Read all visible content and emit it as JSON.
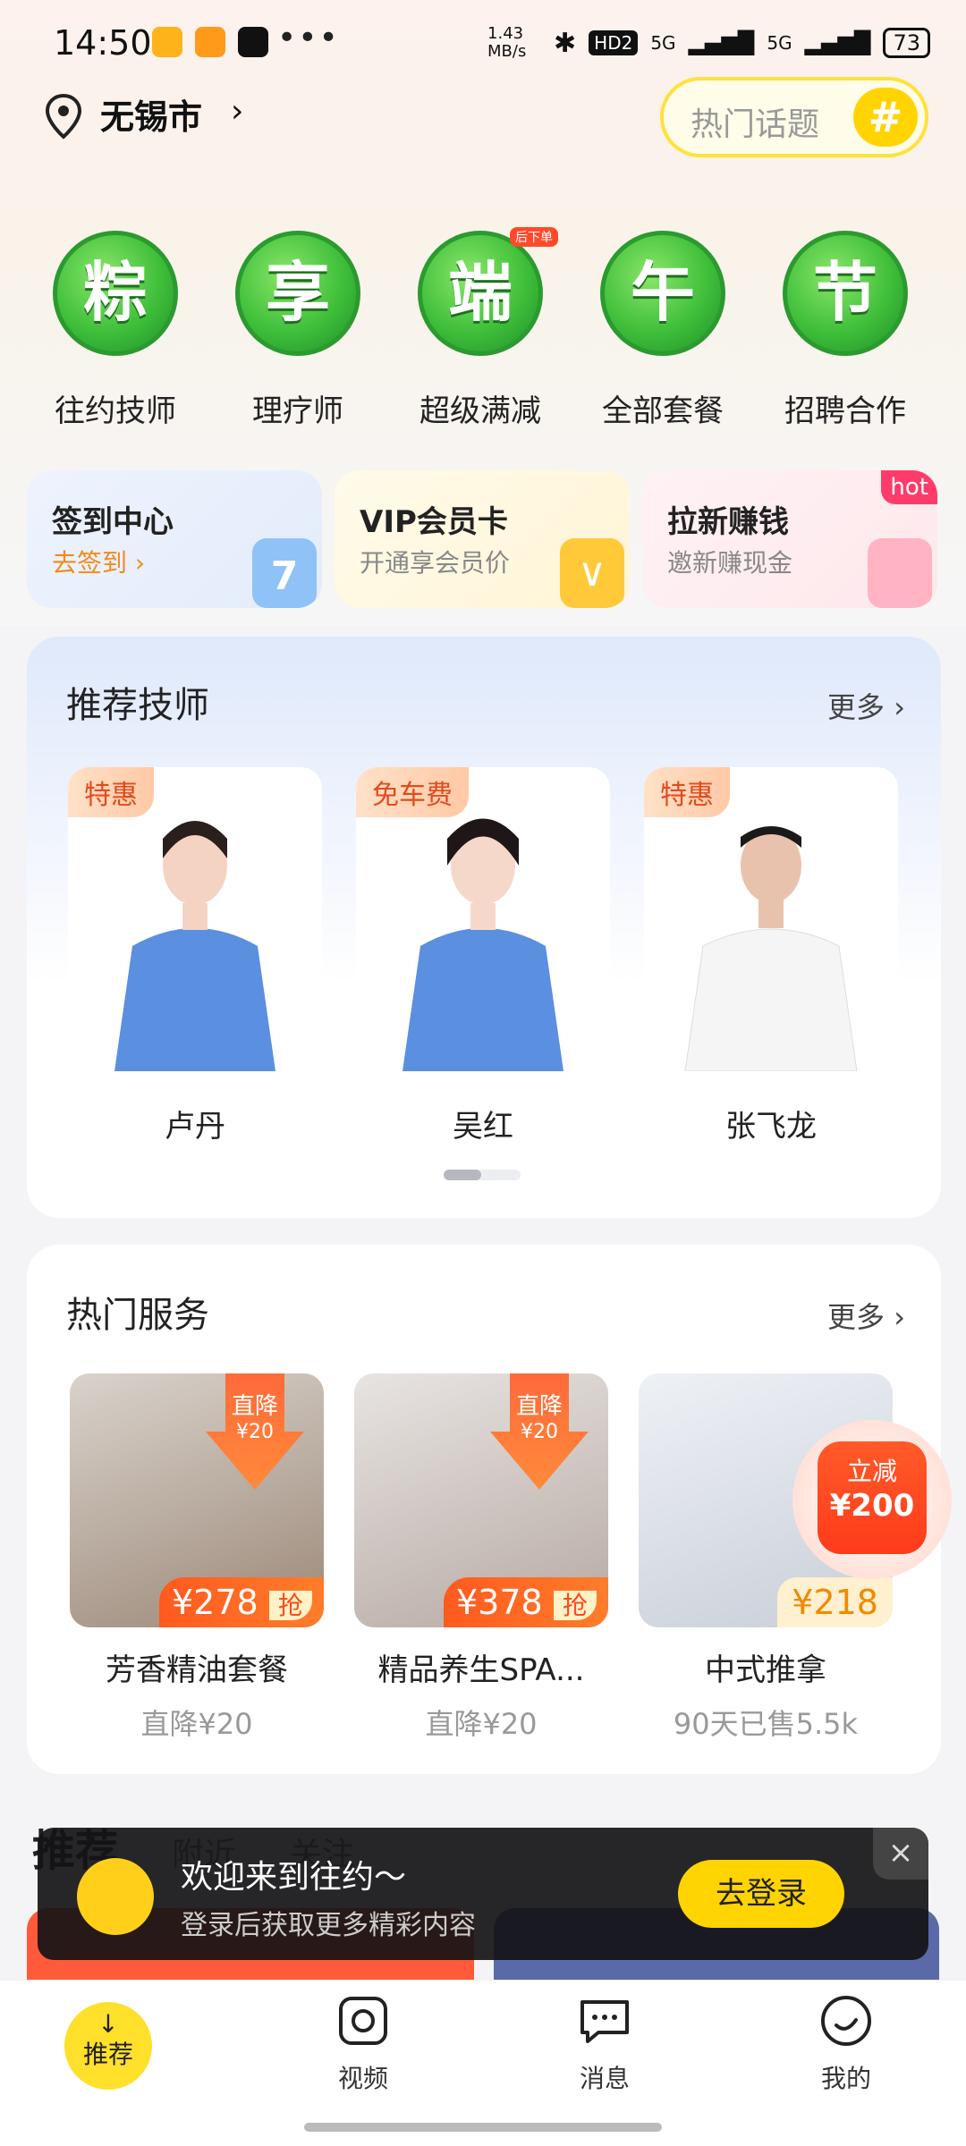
{
  "status": {
    "time": "14:50",
    "more": "•••",
    "net_speed": "1.43 MB/s",
    "hd": "HD2",
    "signal1": "5G",
    "signal2": "5G",
    "battery": "73"
  },
  "header": {
    "city": "无锡市",
    "topic_placeholder": "热门话题",
    "topic_icon": "#"
  },
  "categories": [
    {
      "badge": "粽",
      "label": "往约技师"
    },
    {
      "badge": "享",
      "label": "理疗师"
    },
    {
      "badge": "端",
      "label": "超级满减",
      "tag": "后下单"
    },
    {
      "badge": "午",
      "label": "全部套餐"
    },
    {
      "badge": "节",
      "label": "招聘合作"
    }
  ],
  "quick_cards": [
    {
      "title": "签到中心",
      "sub": "去签到 ›",
      "deco": "7"
    },
    {
      "title": "VIP会员卡",
      "sub": "开通享会员价"
    },
    {
      "title": "拉新赚钱",
      "sub": "邀新赚现金",
      "hot": "hot"
    }
  ],
  "recommended": {
    "title": "推荐技师",
    "more": "更多 ›",
    "items": [
      {
        "tag": "特惠",
        "name": "卢丹"
      },
      {
        "tag": "免车费",
        "name": "吴红"
      },
      {
        "tag": "特惠",
        "name": "张飞龙"
      }
    ]
  },
  "hot_services": {
    "title": "热门服务",
    "more": "更多 ›",
    "items": [
      {
        "drop_a": "直降",
        "drop_b": "¥20",
        "price": "¥278",
        "grab": "抢",
        "name": "芳香精油套餐",
        "sub": "直降¥20"
      },
      {
        "drop_a": "直降",
        "drop_b": "¥20",
        "price": "¥378",
        "grab": "抢",
        "name": "精品养生SPA...",
        "sub": "直降¥20"
      },
      {
        "price": "¥218",
        "name": "中式推拿",
        "sub": "90天已售5.5k"
      }
    ]
  },
  "coupon": {
    "line1": "立减",
    "line2": "¥200"
  },
  "feed_tabs": [
    "推荐",
    "附近",
    "关注"
  ],
  "login": {
    "title": "欢迎来到往约～",
    "sub": "登录后获取更多精彩内容",
    "button": "去登录",
    "close": "×"
  },
  "bottom_nav": {
    "home": "推荐",
    "video": "视频",
    "message": "消息",
    "mine": "我的"
  }
}
